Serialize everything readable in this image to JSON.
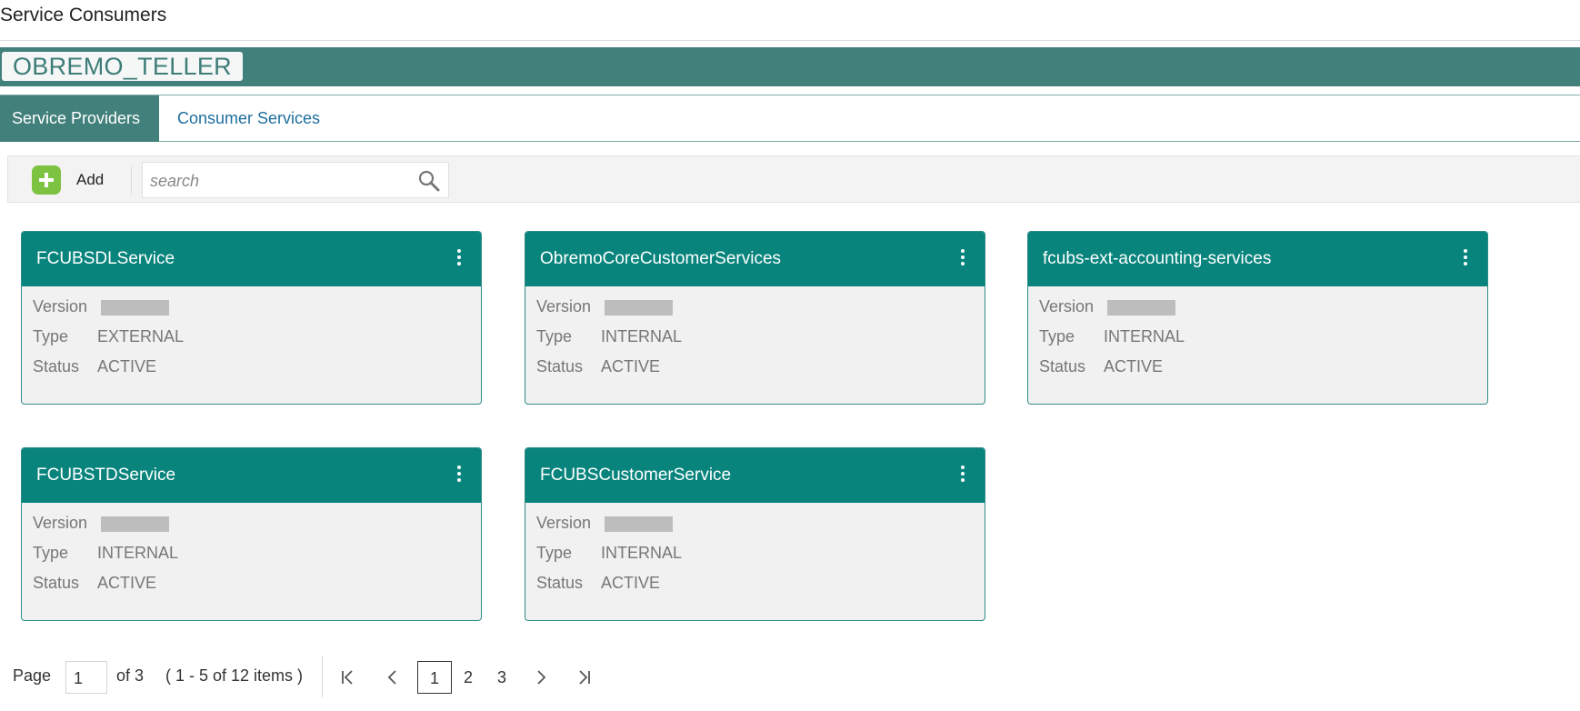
{
  "page": {
    "title": "Service Consumers"
  },
  "consumer": {
    "name": "OBREMO_TELLER"
  },
  "tabs": [
    {
      "label": "Service Providers",
      "active": true
    },
    {
      "label": "Consumer Services",
      "active": false
    }
  ],
  "toolbar": {
    "add_label": "Add",
    "search_placeholder": "search"
  },
  "field_labels": {
    "version": "Version",
    "type": "Type",
    "status": "Status"
  },
  "cards": [
    {
      "title": "FCUBSDLService",
      "type": "EXTERNAL",
      "status": "ACTIVE"
    },
    {
      "title": "ObremoCoreCustomerServices",
      "type": "INTERNAL",
      "status": "ACTIVE"
    },
    {
      "title": "fcubs-ext-accounting-services",
      "type": "INTERNAL",
      "status": "ACTIVE"
    },
    {
      "title": "FCUBSTDService",
      "type": "INTERNAL",
      "status": "ACTIVE"
    },
    {
      "title": "FCUBSCustomerService",
      "type": "INTERNAL",
      "status": "ACTIVE"
    }
  ],
  "pagination": {
    "page_label": "Page",
    "current_page": "1",
    "of_label": "of 3",
    "items_summary": "( 1 - 5 of 12 items )",
    "pages": [
      "1",
      "2",
      "3"
    ]
  },
  "colors": {
    "teal": "#08847d",
    "banner": "#42807b",
    "link": "#1f6f9e",
    "add_green": "#7dc241"
  }
}
